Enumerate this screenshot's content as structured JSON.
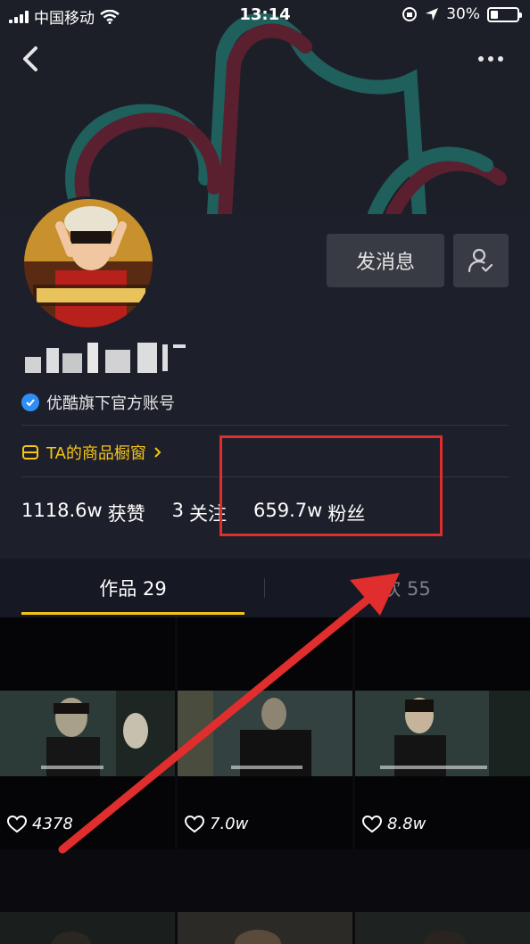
{
  "status_bar": {
    "carrier": "中国移动",
    "time": "13:14",
    "battery": "30%",
    "battery_level": 0.3
  },
  "header": {
    "back_icon": "chevron-left-icon",
    "more_icon": "more-dots-icon"
  },
  "profile": {
    "message_label": "发消息",
    "follow_icon": "user-check-icon",
    "verified_text": "优酷旗下官方账号",
    "shop_label": "TA的商品橱窗",
    "stats": [
      {
        "value": "1118.6w",
        "label": "获赞"
      },
      {
        "value": "3",
        "label": "关注"
      },
      {
        "value": "659.7w",
        "label": "粉丝"
      }
    ]
  },
  "tabs": [
    {
      "label": "作品 29"
    },
    {
      "label": "喜欢 55"
    }
  ],
  "videos": [
    {
      "likes": "4378"
    },
    {
      "likes": "7.0w"
    },
    {
      "likes": "8.8w"
    }
  ],
  "colors": {
    "accent": "#f5c518",
    "annotation": "#e02d2d",
    "verified": "#2f8ef6"
  }
}
